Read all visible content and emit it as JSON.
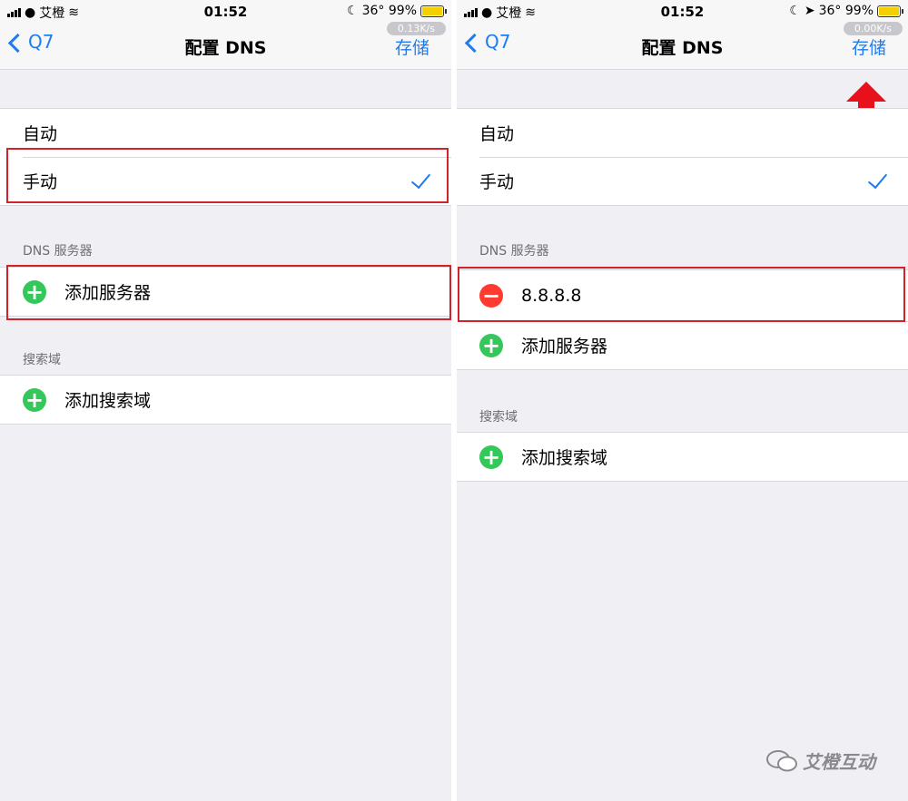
{
  "left": {
    "status": {
      "carrier": "艾橙",
      "time": "01:52",
      "battery_info": "36° 99%",
      "speed": "0.13K/s"
    },
    "nav": {
      "back_label": "Q7",
      "title": "配置 DNS",
      "save_label": "存储"
    },
    "config_options": [
      {
        "label": "自动"
      },
      {
        "label": "手动",
        "checked": true
      }
    ],
    "dns_header": "DNS 服务器",
    "add_server_label": "添加服务器",
    "search_header": "搜索域",
    "add_search_label": "添加搜索域"
  },
  "right": {
    "status": {
      "carrier": "艾橙",
      "time": "01:52",
      "battery_info": "36° 99%",
      "speed": "0.00K/s"
    },
    "nav": {
      "back_label": "Q7",
      "title": "配置 DNS",
      "save_label": "存储"
    },
    "config_options": [
      {
        "label": "自动"
      },
      {
        "label": "手动",
        "checked": true
      }
    ],
    "dns_header": "DNS 服务器",
    "dns_servers": [
      "8.8.8.8"
    ],
    "add_server_label": "添加服务器",
    "search_header": "搜索域",
    "add_search_label": "添加搜索域"
  },
  "watermark": "艾橙互动",
  "colors": {
    "accent": "#1e7cf0",
    "highlight": "#d2232a",
    "add": "#34c759",
    "remove": "#ff3b30"
  }
}
